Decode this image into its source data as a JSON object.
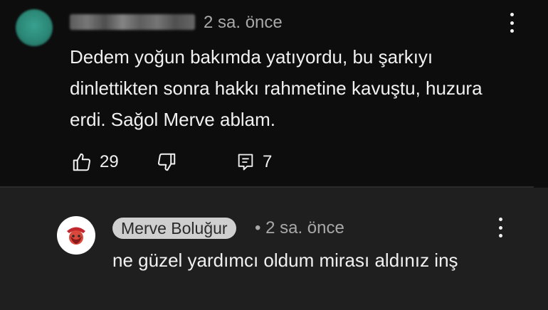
{
  "top_comment": {
    "author": "",
    "author_blurred": true,
    "timestamp": "2 sa. önce",
    "text": "Dedem yoğun bakımda yatıyordu, bu şarkıyı dinlettikten sonra hakkı rahmetine kavuştu, huzura erdi. Sağol Merve ablam.",
    "like_count": "29",
    "reply_count": "7",
    "avatar_color": "#2b8776",
    "icons": {
      "like": "thumbs-up-icon",
      "dislike": "thumbs-down-icon",
      "reply": "comment-icon",
      "more": "more-vert-icon"
    }
  },
  "reply": {
    "author": "Merve Boluğur",
    "separator": "•",
    "timestamp": "2 sa. önce",
    "text": "ne güzel yardımcı oldum mirası aldınız inş",
    "author_chip_color": "#cfcfcf"
  },
  "colors": {
    "background": "#0d0d0d",
    "reply_background": "#1f1f1f",
    "text": "#f1f1f1",
    "secondary_text": "#a8a8a8"
  }
}
